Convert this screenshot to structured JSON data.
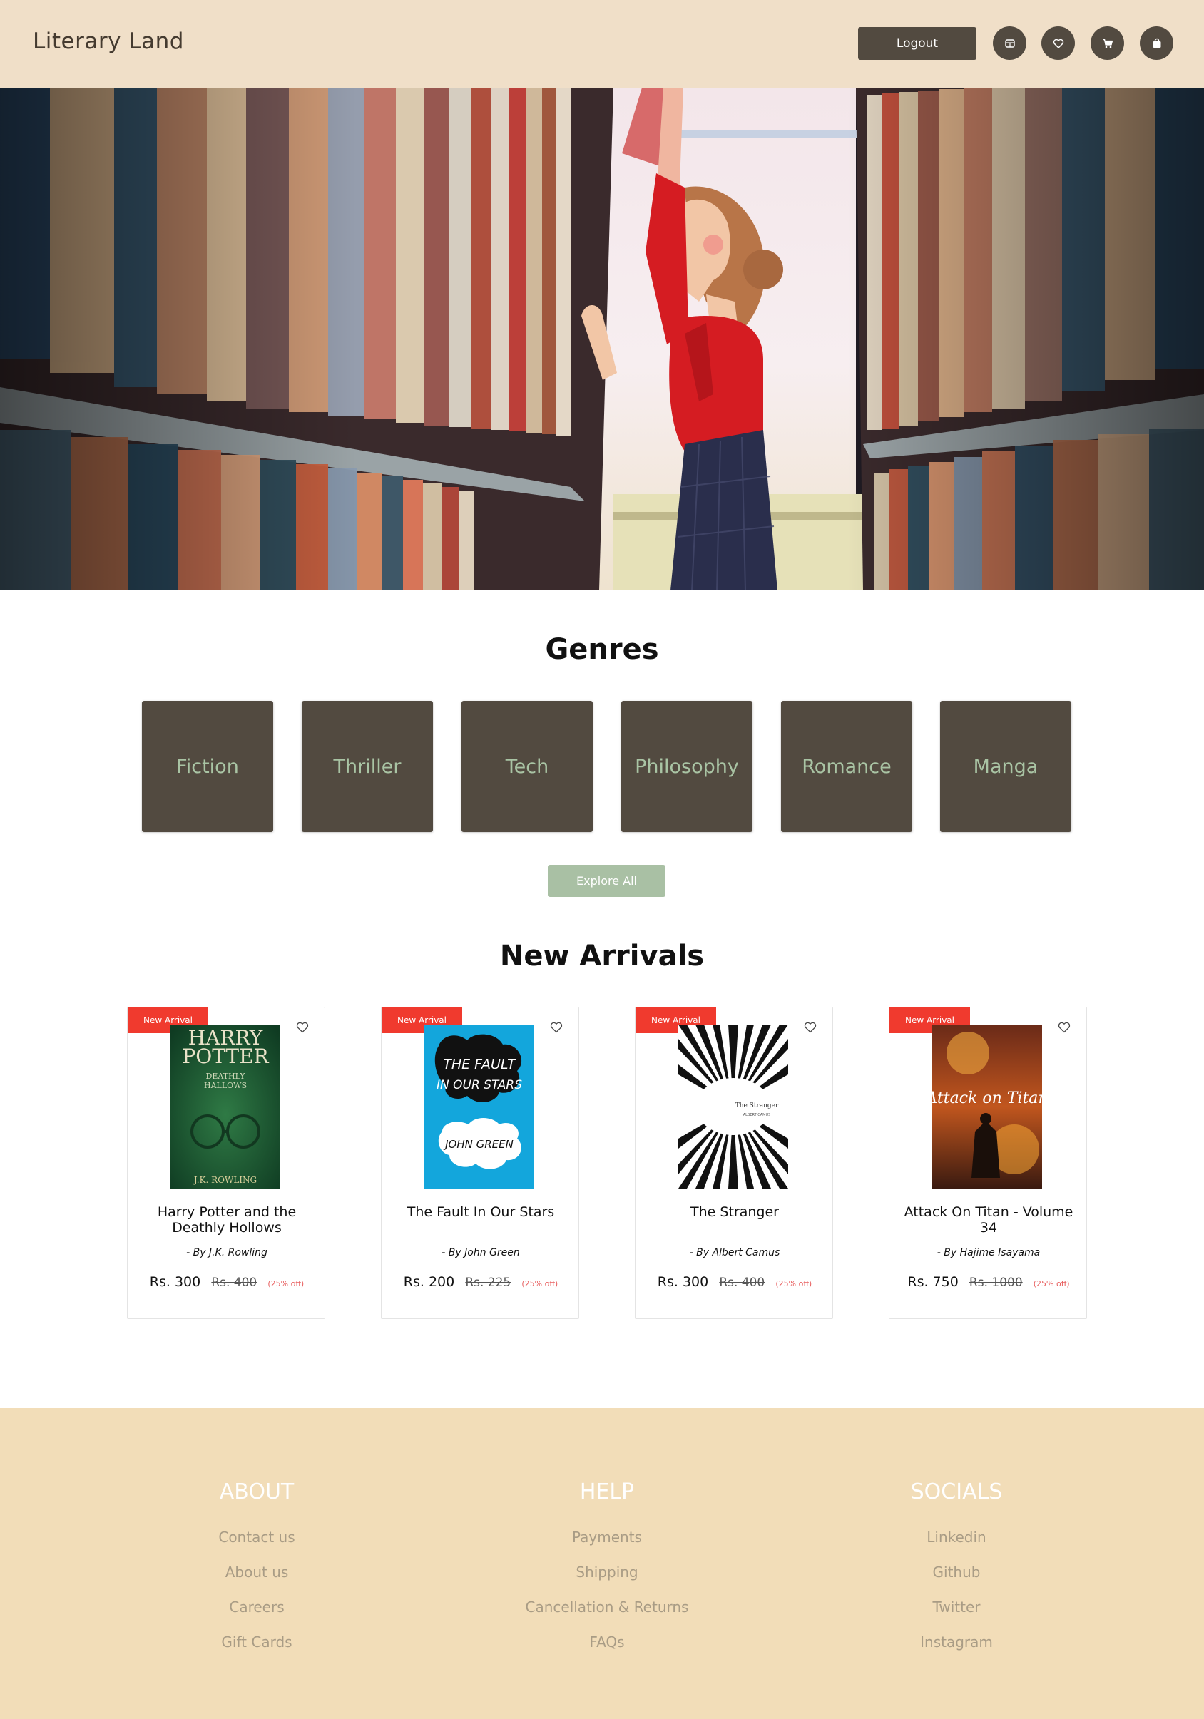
{
  "header": {
    "logo": "Literary Land",
    "logout_label": "Logout",
    "icons": [
      "library-icon",
      "heart-icon",
      "cart-icon",
      "bag-icon"
    ]
  },
  "genres": {
    "title": "Genres",
    "items": [
      "Fiction",
      "Thriller",
      "Tech",
      "Philosophy",
      "Romance",
      "Manga"
    ],
    "explore_label": "Explore All"
  },
  "new_arrivals": {
    "title": "New Arrivals",
    "books": [
      {
        "badge": "New Arrival",
        "title": "Harry Potter and the Deathly Hollows",
        "author": "- By  J.K. Rowling",
        "price": "Rs. 300",
        "mrp": "Rs. 400",
        "discount": "(25% off)",
        "cover_text": [
          "HARRY",
          "POTTER",
          "DEATHLY",
          "HALLOWS",
          "J.K. ROWLING"
        ]
      },
      {
        "badge": "New Arrival",
        "title": "The Fault In Our Stars",
        "author": "- By  John Green",
        "price": "Rs. 200",
        "mrp": "Rs. 225",
        "discount": "(25% off)",
        "cover_text": [
          "THE FAULT",
          "IN OUR STARS",
          "JOHN GREEN"
        ]
      },
      {
        "badge": "New Arrival",
        "title": "The Stranger",
        "author": "- By  Albert Camus",
        "price": "Rs. 300",
        "mrp": "Rs. 400",
        "discount": "(25% off)",
        "cover_text": [
          "The Stranger",
          "ALBERT CAMUS"
        ]
      },
      {
        "badge": "New Arrival",
        "title": "Attack On Titan - Volume 34",
        "author": "- By  Hajime Isayama",
        "price": "Rs. 750",
        "mrp": "Rs. 1000",
        "discount": "(25% off)",
        "cover_text": [
          "Attack on Titan"
        ]
      }
    ]
  },
  "footer": {
    "columns": [
      {
        "heading": "ABOUT",
        "links": [
          "Contact us",
          "About us",
          "Careers",
          "Gift Cards"
        ]
      },
      {
        "heading": "HELP",
        "links": [
          "Payments",
          "Shipping",
          "Cancellation & Returns",
          "FAQs"
        ]
      },
      {
        "heading": "SOCIALS",
        "links": [
          "Linkedin",
          "Github",
          "Twitter",
          "Instagram"
        ]
      }
    ]
  },
  "colors": {
    "header_bg": "#f0dfc8",
    "dark_brown": "#524a40",
    "sage": "#a9c0a4",
    "badge_red": "#f03a2e",
    "footer_bg": "#f2ddb8"
  }
}
